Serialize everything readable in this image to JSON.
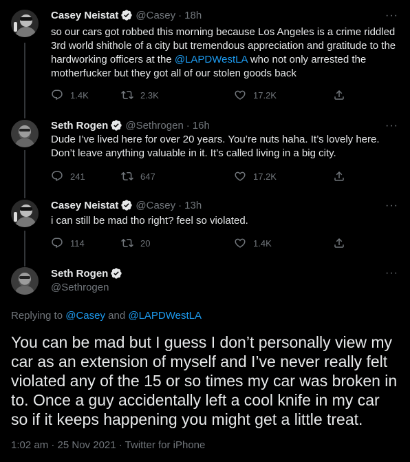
{
  "tweets": [
    {
      "name": "Casey Neistat",
      "handle": "@Casey",
      "time": "18h",
      "text_before": "so our cars got robbed this morning because Los Angeles is a crime riddled 3rd world shithole of a city but tremendous appreciation and gratitude to the hardworking officers at the ",
      "mention": "@LAPDWestLA",
      "text_after": " who not only arrested the motherfucker but they got all of our stolen goods back",
      "replies": "1.4K",
      "retweets": "2.3K",
      "likes": "17.2K"
    },
    {
      "name": "Seth Rogen",
      "handle": "@Sethrogen",
      "time": "16h",
      "text": "Dude I’ve lived here for over 20 years. You’re nuts haha. It’s lovely here. Don’t leave anything valuable in it. It’s called living in a big city.",
      "replies": "241",
      "retweets": "647",
      "likes": "17.2K"
    },
    {
      "name": "Casey Neistat",
      "handle": "@Casey",
      "time": "13h",
      "text": "i can still be mad tho right?  feel so violated.",
      "replies": "114",
      "retweets": "20",
      "likes": "1.4K"
    }
  ],
  "focused": {
    "name": "Seth Rogen",
    "handle": "@Sethrogen",
    "replying_prefix": "Replying to ",
    "replying_mention_1": "@Casey",
    "replying_and": " and ",
    "replying_mention_2": "@LAPDWestLA",
    "text": "You can be mad but I guess I don’t personally view my car as an extension of myself and I’ve never really felt violated any of the 15 or so times my car was broken in to. Once a guy accidentally left a cool knife in my car so if it keeps happening you might get a little treat.",
    "timestamp": "1:02 am · 25 Nov 2021 · Twitter for iPhone"
  },
  "separator": "·",
  "more_glyph": "···",
  "colors": {
    "accent": "#1d9bf0",
    "muted": "#71767b",
    "text": "#e7e9ea",
    "background": "#000000"
  },
  "icons": [
    "reply-icon",
    "retweet-icon",
    "like-icon",
    "share-icon",
    "verified-badge-icon",
    "more-icon"
  ]
}
